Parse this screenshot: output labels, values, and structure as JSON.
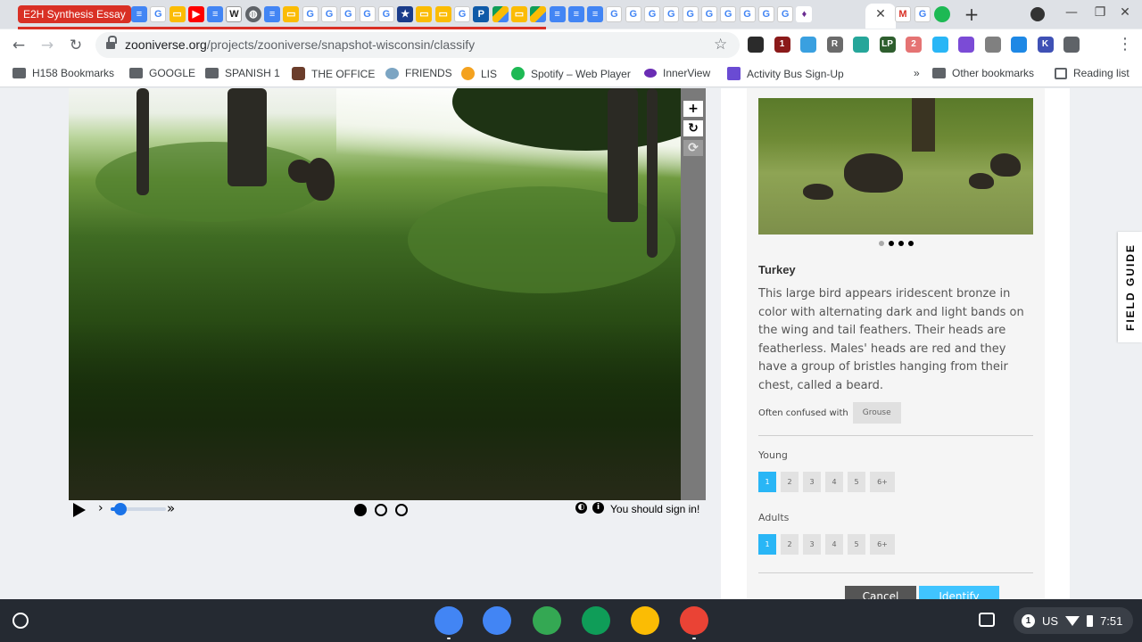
{
  "browser": {
    "tab_group_label": "E2H Synthesis Essay",
    "tab_icons_before_active": [
      "doc",
      "g",
      "slide",
      "yt",
      "doc",
      "w",
      "globe",
      "doc",
      "slide",
      "g",
      "g",
      "g",
      "g",
      "g",
      "star",
      "slide",
      "slide",
      "g",
      "p",
      "drive",
      "slide",
      "drive",
      "doc",
      "doc",
      "doc",
      "g",
      "g",
      "g",
      "g",
      "g",
      "g",
      "g",
      "g",
      "g",
      "g",
      "purple"
    ],
    "active_tab_close": "✕",
    "tab_icons_after_active": [
      {
        "kind": "gm",
        "label": "M"
      },
      {
        "kind": "g",
        "label": "G"
      },
      {
        "kind": "spot",
        "label": ""
      }
    ],
    "new_tab": "+",
    "window_controls": [
      "—",
      "❐",
      "✕"
    ],
    "url_domain": "zooniverse.org",
    "url_path": "/projects/zooniverse/snapshot-wisconsin/classify",
    "nav": {
      "back": "←",
      "forward": "→",
      "reload": "↻"
    },
    "extensions": [
      {
        "color": "#2b2b2b",
        "label": ""
      },
      {
        "color": "#8b1a1a",
        "label": "1"
      },
      {
        "color": "#3aa0e0",
        "label": ""
      },
      {
        "color": "#6b6b6b",
        "label": "R"
      },
      {
        "color": "#26a69a",
        "label": ""
      },
      {
        "color": "#2e5e2e",
        "label": "LP"
      },
      {
        "color": "#e57373",
        "label": "2"
      },
      {
        "color": "#29b6f6",
        "label": ""
      },
      {
        "color": "#7b4bd6",
        "label": ""
      },
      {
        "color": "#808080",
        "label": ""
      },
      {
        "color": "#1e88e5",
        "label": ""
      },
      {
        "color": "#3f51b5",
        "label": "K"
      },
      {
        "color": "#5f6368",
        "label": ""
      }
    ],
    "bookmarks": [
      {
        "label": "H158 Bookmarks",
        "icon": "ic"
      },
      {
        "label": "GOOGLE",
        "icon": "ic"
      },
      {
        "label": "SPANISH 1",
        "icon": "ic"
      },
      {
        "label": "THE OFFICE",
        "icon": "ic office"
      },
      {
        "label": "FRIENDS",
        "icon": "ic friends"
      },
      {
        "label": "LIS",
        "icon": "ic orange"
      },
      {
        "label": "Spotify – Web Player",
        "icon": "ic spot"
      },
      {
        "label": "InnerView",
        "icon": "ic purple"
      },
      {
        "label": "Activity Bus Sign-Up",
        "icon": "ic act"
      }
    ],
    "bookmarks_overflow": "»",
    "other_bookmarks": "Other bookmarks",
    "reading_list": "Reading list"
  },
  "viewer": {
    "signin_text": "You should sign in!",
    "frame_count": 3,
    "current_frame": 1,
    "playback_speed_fraction": 0.18,
    "tools": [
      "+",
      "↻",
      "⟳"
    ]
  },
  "field_guide": {
    "tab_label": "FIELD GUIDE",
    "species": "Turkey",
    "description": "This large bird appears iridescent bronze in color with alternating dark and light bands on the wing and tail feathers. Their heads are featherless. Males' heads are red and they have a group of bristles hanging from their chest, called a beard.",
    "confused_label": "Often confused with",
    "confused_with": "Grouse",
    "carousel": {
      "total": 4,
      "current": 1
    },
    "young_label": "Young",
    "adults_label": "Adults",
    "count_options": [
      "1",
      "2",
      "3",
      "4",
      "5",
      "6+"
    ],
    "young_selected": "1",
    "adults_selected": "1",
    "cancel_label": "Cancel",
    "identify_label": "Identify"
  },
  "shelf": {
    "apps": [
      {
        "name": "chrome",
        "color": "#4285f4"
      },
      {
        "name": "docs",
        "color": "#4285f4"
      },
      {
        "name": "play-store",
        "color": "#34a853"
      },
      {
        "name": "classroom",
        "color": "#0f9d58"
      },
      {
        "name": "slides",
        "color": "#fbbc04"
      },
      {
        "name": "gmail",
        "color": "#ea4335"
      }
    ],
    "notification_count": "1",
    "ime": "US",
    "time": "7:51"
  }
}
